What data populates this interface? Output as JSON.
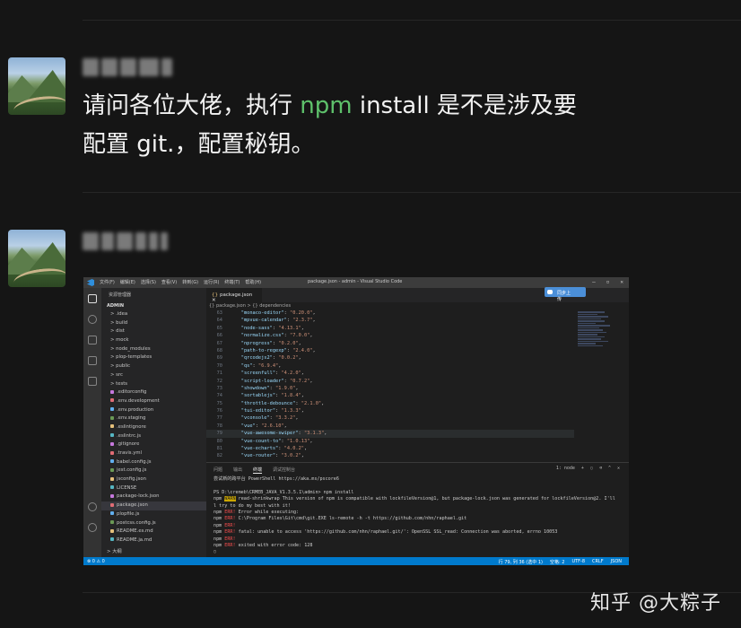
{
  "messages": [
    {
      "text_part1": "请问各位大佬，执行 ",
      "text_highlight": "npm",
      "text_part2": " install 是不是涉及要",
      "text_line2": "配置 git.，配置秘钥。"
    }
  ],
  "screenshot": {
    "window_title": "package.json - admin - Visual Studio Code",
    "menu": [
      "文件(F)",
      "编辑(E)",
      "选择(S)",
      "查看(V)",
      "转到(G)",
      "运行(R)",
      "终端(T)",
      "帮助(H)"
    ],
    "sidebar_header": "资源管理器",
    "root_folder": "ADMIN",
    "files": [
      "> .idea",
      "> build",
      "> dist",
      "> mock",
      "> node_modules",
      "> plop-templates",
      "> public",
      "> src",
      "> tests",
      ".editorconfig",
      ".env.development",
      ".env.production",
      ".env.staging",
      ".eslintignore",
      ".eslintrc.js",
      ".gitignore",
      ".travis.yml",
      "babel.config.js",
      "jest.config.js",
      "jsconfig.json",
      "LICENSE",
      "package-lock.json",
      "package.json",
      "plopfile.js",
      "postcss.config.js",
      "README.es.md",
      "README.ja.md"
    ],
    "outline_label": "> 大纲",
    "tab_label": "package.json",
    "badge_label": "同步上传",
    "breadcrumb": "{} package.json > {} dependencies",
    "code_lines": [
      {
        "n": "63",
        "k": "\"monaco-editor\"",
        "v": "\"0.20.0\""
      },
      {
        "n": "64",
        "k": "\"mpvue-calendar\"",
        "v": "\"2.3.7\""
      },
      {
        "n": "65",
        "k": "\"node-sass\"",
        "v": "\"4.13.1\""
      },
      {
        "n": "66",
        "k": "\"normalize.css\"",
        "v": "\"7.0.0\""
      },
      {
        "n": "67",
        "k": "\"nprogress\"",
        "v": "\"0.2.0\""
      },
      {
        "n": "68",
        "k": "\"path-to-regexp\"",
        "v": "\"2.4.0\""
      },
      {
        "n": "69",
        "k": "\"qrcodejs2\"",
        "v": "\"0.0.2\""
      },
      {
        "n": "70",
        "k": "\"qs\"",
        "v": "\"6.9.4\""
      },
      {
        "n": "71",
        "k": "\"screenfull\"",
        "v": "\"4.2.0\""
      },
      {
        "n": "72",
        "k": "\"script-loader\"",
        "v": "\"0.7.2\""
      },
      {
        "n": "73",
        "k": "\"showdown\"",
        "v": "\"1.9.0\""
      },
      {
        "n": "74",
        "k": "\"sortablejs\"",
        "v": "\"1.8.4\""
      },
      {
        "n": "75",
        "k": "\"throttle-debounce\"",
        "v": "\"2.1.0\""
      },
      {
        "n": "76",
        "k": "\"tui-editor\"",
        "v": "\"1.3.3\""
      },
      {
        "n": "77",
        "k": "\"vconsole\"",
        "v": "\"3.3.2\""
      },
      {
        "n": "78",
        "k": "\"vue\"",
        "v": "\"2.6.10\""
      },
      {
        "n": "79",
        "k": "\"vue-awesome-swiper\"",
        "v": "\"3.1.3\""
      },
      {
        "n": "80",
        "k": "\"vue-count-to\"",
        "v": "\"1.0.13\""
      },
      {
        "n": "81",
        "k": "\"vue-echarts\"",
        "v": "\"4.0.2\""
      },
      {
        "n": "82",
        "k": "\"vue-router\"",
        "v": "\"3.0.2\""
      }
    ],
    "panel_tabs": [
      "问题",
      "输出",
      "终端",
      "调试控制台"
    ],
    "panel_controls": "1: node",
    "terminal": {
      "t1": "尝试新的跨平台 PowerShell https://aka.ms/pscore6",
      "t2": "PS D:\\cremeb\\CRMEB_JAVA_V1.3.5.1\\admin> npm install",
      "t3a": "npm ",
      "t3warn": "WARN",
      "t3b": " read-shrinkwrap This version of npm is compatible with lockfileVersion@1, but package-lock.json was generated for lockfileVersion@2. I'll",
      "t4": "l try to do my best with it!",
      "t5a": "npm ",
      "t5err": "ERR!",
      "t5b": " Error while executing:",
      "t6b": " C:\\Program Files\\Git\\cmd\\git.EXE ls-remote -h -t https://github.com/nhn/raphael.git",
      "t8b": " fatal: unable to access 'https://github.com/nhn/raphael.git/': OpenSSL SSL_read: Connection was aborted, errno 10053",
      "t10b": " exited with error code: 128"
    },
    "status_left": "⊗ 0 ⚠ 0",
    "status_right": [
      "行 79, 列 36 (选中 1)",
      "空格: 2",
      "UTF-8",
      "CRLF",
      "JSON"
    ]
  },
  "watermark": "知乎 @大粽子"
}
